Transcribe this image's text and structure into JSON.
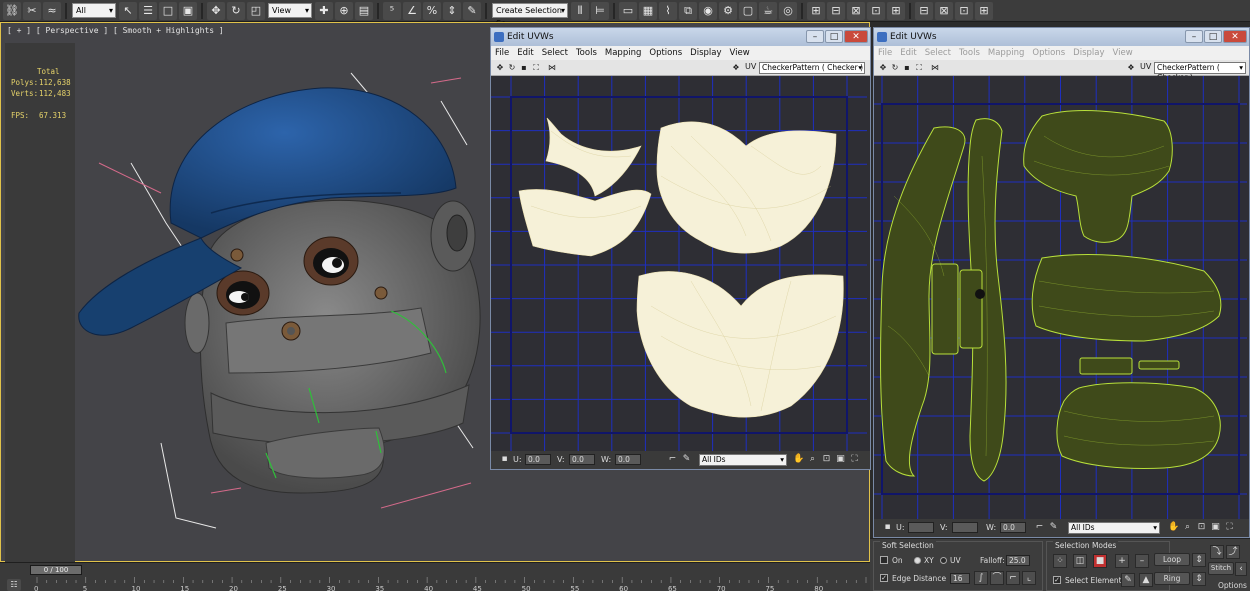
{
  "toolbar": {
    "selection_filter": "All",
    "reference_coord": "View",
    "named_selection": "Create Selection Se"
  },
  "viewport": {
    "label": "[ + ] [ Perspective ] [ Smooth + Highlights ]",
    "stats": {
      "total_label": "Total",
      "polys_label": "Polys:",
      "polys_value": "112,638",
      "verts_label": "Verts:",
      "verts_value": "112,483",
      "fps_label": "FPS:",
      "fps_value": "67.313"
    }
  },
  "uv_window_1": {
    "title": "Edit UVWs",
    "menu": [
      "File",
      "Edit",
      "Select",
      "Tools",
      "Mapping",
      "Options",
      "Display",
      "View"
    ],
    "uv_label": "UV",
    "texture_dropdown": "CheckerPattern  ( Checker )",
    "u_label": "U:",
    "u_value": "0.0",
    "v_label": "V:",
    "v_value": "0.0",
    "w_label": "W:",
    "w_value": "0.0",
    "ids_dropdown": "All IDs",
    "buttons": {
      "min": "–",
      "max": "□",
      "close": "✕"
    }
  },
  "uv_window_2": {
    "title": "Edit UVWs",
    "menu": [
      "File",
      "Edit",
      "Select",
      "Tools",
      "Mapping",
      "Options",
      "Display",
      "View"
    ],
    "uv_label": "UV",
    "texture_dropdown": "CheckerPattern  ( Checker )",
    "u_label": "U:",
    "u_value": "",
    "v_label": "V:",
    "v_value": "",
    "w_label": "W:",
    "w_value": "0.0",
    "ids_dropdown": "All IDs",
    "buttons": {
      "min": "–",
      "max": "□",
      "close": "✕"
    }
  },
  "timeline": {
    "slider_text": "0 / 100",
    "ticks": [
      0,
      5,
      10,
      15,
      20,
      25,
      30,
      35,
      40,
      45,
      50,
      55,
      60,
      65,
      70,
      75,
      80
    ],
    "slider_fraction": 0.0
  },
  "panel": {
    "soft_selection_title": "Soft Selection",
    "on_label": "On",
    "xy_label": "XY",
    "uv_label": "UV",
    "falloff_label": "Falloff:",
    "falloff_value": "25.0",
    "edge_distance_label": "Edge Distance",
    "edge_distance_value": "16",
    "selection_modes_title": "Selection Modes",
    "select_element_label": "Select Element",
    "loop_label": "Loop",
    "ring_label": "Ring",
    "stitch_label": "Stitch",
    "options_label": "Options"
  },
  "colors": {
    "viewport_border": "#e0c24a",
    "stats_text": "#e6d36a",
    "uv_grid": "#1e2fc0",
    "uv_border": "#10156a",
    "uv_shell_line": "#b8e03a",
    "cap_blue": "#1f4d8a"
  },
  "icons": {
    "toolbar": [
      "link-icon",
      "unlink-icon",
      "bind-icon",
      "select-object-icon",
      "select-name-icon",
      "rect-region-icon",
      "window-cross-icon",
      "move-icon",
      "rotate-icon",
      "scale-icon",
      "pivot-icon",
      "snap-icon",
      "angle-snap-icon",
      "percent-snap-icon",
      "spinner-snap-icon",
      "mirror-icon",
      "align-icon",
      "layers-icon",
      "ribbon-icon",
      "curve-editor-icon",
      "schematic-icon",
      "material-editor-icon",
      "render-setup-icon",
      "render-icon",
      "quick-render-icon"
    ]
  }
}
